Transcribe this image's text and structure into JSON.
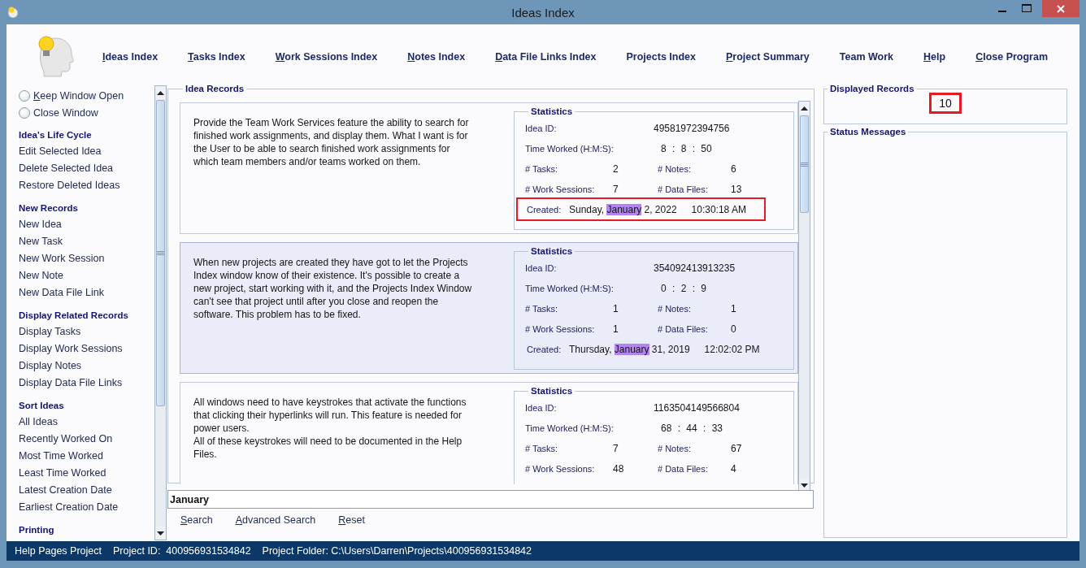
{
  "window": {
    "title": "Ideas Index"
  },
  "nav_links": [
    {
      "label": "Ideas Index",
      "mnemonic_first": true
    },
    {
      "label": "Tasks Index",
      "mnemonic_first": true
    },
    {
      "label": "Work Sessions Index",
      "mnemonic_first": true
    },
    {
      "label": "Notes Index",
      "mnemonic_first": true
    },
    {
      "label": "Data File Links Index",
      "mnemonic_first": true
    },
    {
      "label": "Projects Index",
      "mnemonic_first": false
    },
    {
      "label": "Project Summary",
      "mnemonic_first": true
    },
    {
      "label": "Team Work",
      "mnemonic_first": false
    },
    {
      "label": "Help",
      "mnemonic_first": true
    },
    {
      "label": "Close Program",
      "mnemonic_first": true
    }
  ],
  "window_options": [
    {
      "label": "Keep Window Open",
      "selected": false,
      "mnemonic_first": true
    },
    {
      "label": "Close Window",
      "selected": false,
      "mnemonic_first": false
    }
  ],
  "sidebar_sections": [
    {
      "title": "Idea's Life Cycle",
      "items": [
        "Edit Selected Idea",
        "Delete Selected Idea",
        "Restore Deleted Ideas"
      ]
    },
    {
      "title": "New Records",
      "items": [
        "New Idea",
        "New Task",
        "New Work Session",
        "New Note",
        "New Data File Link"
      ]
    },
    {
      "title": "Display Related Records",
      "items": [
        "Display Tasks",
        "Display Work Sessions",
        "Display Notes",
        "Display Data File Links"
      ]
    },
    {
      "title": "Sort Ideas",
      "items": [
        "All Ideas",
        "Recently Worked On",
        "Most Time Worked",
        "Least Time Worked",
        "Latest Creation Date",
        "Earliest Creation Date"
      ]
    },
    {
      "title": "Printing"
    }
  ],
  "idea_records": {
    "title": "Idea Records",
    "cards": [
      {
        "selected": false,
        "description": "Provide the Team Work Services feature the ability to search for finished work assignments, and display them. What I want is for the User to be able to search finished work assignments for which team members and/or teams worked on them.",
        "statistics": {
          "title": "Statistics",
          "id_label": "Idea ID:",
          "id": "49581972394756",
          "time_label": "Time Worked (H:M:S):",
          "time": "8 : 8 : 50",
          "tasks_label": "# Tasks:",
          "tasks": "2",
          "notes_label": "# Notes:",
          "notes": "6",
          "sessions_label": "# Work Sessions:",
          "sessions": "7",
          "files_label": "# Data Files:",
          "files": "13",
          "created_label": "Created:",
          "created": {
            "before": "Sunday, ",
            "match": "January",
            "after": " 2, 2022",
            "time": "10:30:18 AM",
            "highlighted": true
          }
        }
      },
      {
        "selected": true,
        "description": "When new projects are created they have got to let the Projects Index window know of their existence. It's possible to create a new project, start working with it, and the Projects Index Window can't see that project until after you close and reopen the software. This problem has to be fixed.",
        "statistics": {
          "title": "Statistics",
          "id_label": "Idea ID:",
          "id": "354092413913235",
          "time_label": "Time Worked (H:M:S):",
          "time": "0 : 2 : 9",
          "tasks_label": "# Tasks:",
          "tasks": "1",
          "notes_label": "# Notes:",
          "notes": "1",
          "sessions_label": "# Work Sessions:",
          "sessions": "1",
          "files_label": "# Data Files:",
          "files": "0",
          "created_label": "Created:",
          "created": {
            "before": "Thursday, ",
            "match": "January",
            "after": " 31, 2019",
            "time": "12:02:02 PM",
            "highlighted": false
          }
        }
      },
      {
        "selected": false,
        "description": "All windows need to have keystrokes that activate the functions that clicking their hyperlinks will run. This feature is needed for power users.\nAll of these keystrokes will need to be documented in the Help Files.",
        "statistics": {
          "title": "Statistics",
          "id_label": "Idea ID:",
          "id": "1163504149566804",
          "time_label": "Time Worked (H:M:S):",
          "time": "68 : 44 : 33",
          "tasks_label": "# Tasks:",
          "tasks": "7",
          "notes_label": "# Notes:",
          "notes": "67",
          "sessions_label": "# Work Sessions:",
          "sessions": "48",
          "files_label": "# Data Files:",
          "files": "4"
        }
      }
    ]
  },
  "search": {
    "value": "January"
  },
  "search_buttons": [
    {
      "label": "Search"
    },
    {
      "label": "Advanced Search"
    },
    {
      "label": "Reset"
    }
  ],
  "displayed_records": {
    "title": "Displayed Records",
    "count": "10",
    "highlighted": true
  },
  "status_messages": {
    "title": "Status Messages"
  },
  "status_bar": [
    "Help Pages Project",
    "Project ID:  400956931534842",
    "Project Folder: C:\\Users\\Darren\\Projects\\400956931534842"
  ]
}
